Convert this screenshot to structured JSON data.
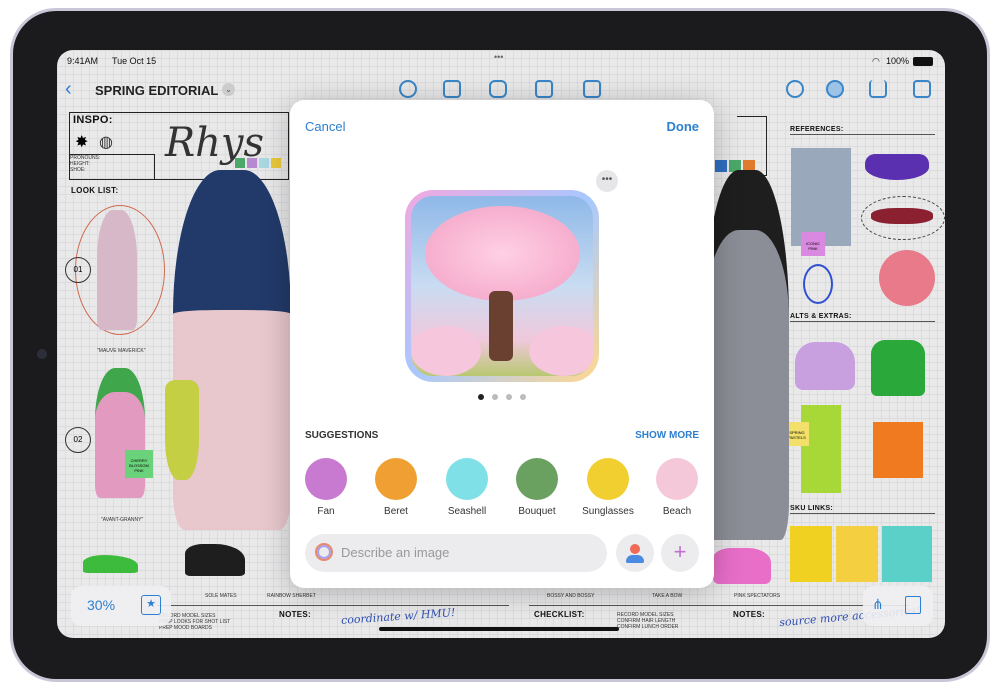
{
  "status_bar": {
    "time": "9:41AM",
    "date": "Tue Oct 15",
    "battery": "100%"
  },
  "toolbar": {
    "title": "SPRING EDITORIAL",
    "icons": [
      "pen-icon",
      "note-icon",
      "shapes-icon",
      "text-box-icon",
      "media-icon",
      "undo-icon",
      "collaborate-icon",
      "share-icon",
      "compose-icon"
    ]
  },
  "board": {
    "inspo": "INSPO:",
    "signature": "Rhys",
    "look_list": "LOOK LIST:",
    "profile": [
      "PRONOUNS:",
      "HEIGHT:",
      "SHOE:"
    ],
    "looks": [
      {
        "num": "01",
        "name": "\"MAUVE MAVERICK\""
      },
      {
        "num": "02",
        "name": "\"AVANT-GRANNY\""
      }
    ],
    "sticky_left": "CHERRY BLOSSOM PINK",
    "references": "REFERENCES:",
    "sticky_ref": "ICONIC PINK",
    "alts": "ALTS & EXTRAS:",
    "sticky_alts": "SPRING PASTELS",
    "sku_links": "SKU LINKS:",
    "shoe_labels": [
      "SOLE MATES",
      "RAINBOW SHERBET",
      "BOSSY AND BOSSY",
      "TAKE A BOW",
      "PINK SPECTATORS"
    ],
    "notes_left": "NOTES:",
    "notes_left_hand": "coordinate w/ HMU!",
    "checklist": "CHECKLIST:",
    "checklist_items": [
      "RECORD MODEL SIZES",
      "CONFIRM HAIR LENGTH",
      "CONFIRM LUNCH ORDER"
    ],
    "left_list": [
      "RECORD MODEL SIZES",
      "PREP LOOKS FOR SHOT LIST",
      "PREP MOOD BOARDS"
    ],
    "notes_right": "NOTES:",
    "notes_right_hand": "source more accessories!",
    "zoom": "30%",
    "swatches": [
      "#4aa86a",
      "#b58ad0",
      "#a8d8e0",
      "#e9c93a"
    ],
    "swatches_right": [
      "#2f6fc0",
      "#4aa86a",
      "#e07a2e"
    ]
  },
  "modal": {
    "cancel": "Cancel",
    "done": "Done",
    "page_dots": 4,
    "active_dot": 1,
    "suggestions_title": "SUGGESTIONS",
    "show_more": "SHOW MORE",
    "suggestions": [
      {
        "label": "Fan",
        "color": "#c77ad0"
      },
      {
        "label": "Beret",
        "color": "#f0a032"
      },
      {
        "label": "Seashell",
        "color": "#7fe0e8"
      },
      {
        "label": "Bouquet",
        "color": "#6aa060"
      },
      {
        "label": "Sunglasses",
        "color": "#f2cf30"
      },
      {
        "label": "Beach",
        "color": "#f4c8d8"
      }
    ],
    "prompt_placeholder": "Describe an image"
  },
  "colors": {
    "accent": "#2d7fd1"
  }
}
